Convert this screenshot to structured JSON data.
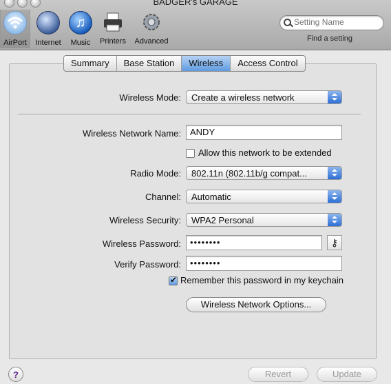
{
  "window": {
    "title": "BADGER's GARAGE"
  },
  "toolbar": {
    "items": [
      {
        "label": "AirPort"
      },
      {
        "label": "Internet"
      },
      {
        "label": "Music"
      },
      {
        "label": "Printers"
      },
      {
        "label": "Advanced"
      }
    ],
    "search_placeholder": "Setting Name",
    "find_label": "Find a setting"
  },
  "tabs": [
    "Summary",
    "Base Station",
    "Wireless",
    "Access Control"
  ],
  "selected_tab": "Wireless",
  "form": {
    "wireless_mode_label": "Wireless Mode:",
    "wireless_mode_value": "Create a wireless network",
    "network_name_label": "Wireless Network Name:",
    "network_name_value": "ANDY",
    "allow_extend_label": "Allow this network to be extended",
    "allow_extend_checked": false,
    "radio_mode_label": "Radio Mode:",
    "radio_mode_value": "802.11n (802.11b/g compat...",
    "channel_label": "Channel:",
    "channel_value": "Automatic",
    "security_label": "Wireless Security:",
    "security_value": "WPA2 Personal",
    "password_label": "Wireless Password:",
    "password_value": "••••••••",
    "verify_label": "Verify Password:",
    "verify_value": "••••••••",
    "remember_label": "Remember this password in my keychain",
    "remember_checked": true,
    "options_button": "Wireless Network Options..."
  },
  "footer": {
    "help": "?",
    "revert": "Revert",
    "update": "Update"
  },
  "colors": {
    "selected_tab": "#5f9be0",
    "popup_arrow": "#2e6fd6",
    "help_mark": "#5a1d8a"
  }
}
